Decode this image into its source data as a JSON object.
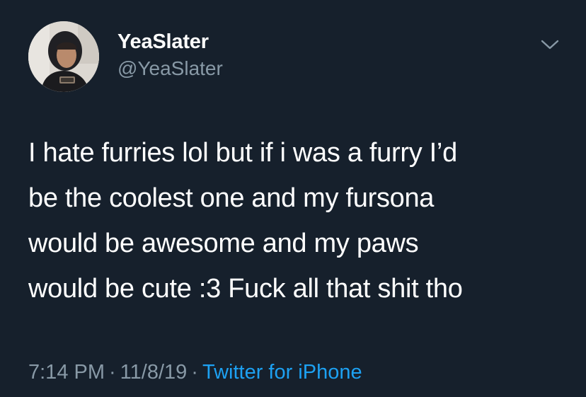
{
  "user": {
    "display_name": "YeaSlater",
    "handle": "@YeaSlater"
  },
  "tweet": {
    "lines": [
      "I hate furries lol but if i was a furry I’d",
      "be the coolest one and my fursona",
      "would be awesome and my paws",
      "would be cute :3 Fuck all that shit tho"
    ],
    "time": "7:14 PM",
    "separator": "·",
    "date": "11/8/19",
    "source": "Twitter for iPhone"
  },
  "icons": {
    "menu": "chevron-down-icon"
  },
  "colors": {
    "background": "#16202c",
    "primary_text": "#ffffff",
    "secondary_text": "#8899a6",
    "link": "#1da1f2"
  }
}
